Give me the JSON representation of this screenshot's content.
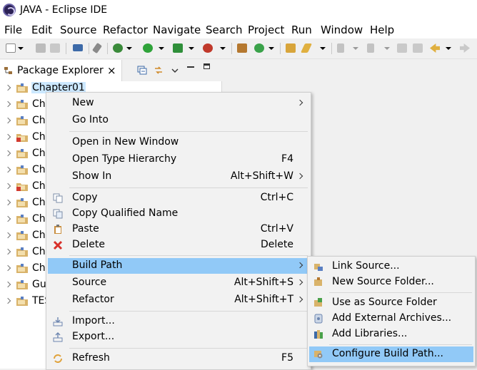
{
  "window": {
    "title": "JAVA - Eclipse IDE"
  },
  "menubar": [
    "File",
    "Edit",
    "Source",
    "Refactor",
    "Navigate",
    "Search",
    "Project",
    "Run",
    "Window",
    "Help"
  ],
  "package_explorer": {
    "tab_title": "Package Explorer",
    "close_glyph": "×",
    "items": [
      {
        "label": "Chapter01"
      },
      {
        "label": "Ch"
      },
      {
        "label": "Ch"
      },
      {
        "label": "Ch"
      },
      {
        "label": "Ch"
      },
      {
        "label": "Ch"
      },
      {
        "label": "Ch"
      },
      {
        "label": "Ch"
      },
      {
        "label": "Ch"
      },
      {
        "label": "Ch"
      },
      {
        "label": "Ch"
      },
      {
        "label": "Ch"
      },
      {
        "label": "Gu"
      },
      {
        "label": "TES"
      }
    ]
  },
  "context_menu": {
    "new": "New",
    "go_into": "Go Into",
    "open_new_window": "Open in New Window",
    "open_type_hierarchy": "Open Type Hierarchy",
    "open_type_hierarchy_sc": "F4",
    "show_in": "Show In",
    "show_in_sc": "Alt+Shift+W",
    "copy": "Copy",
    "copy_sc": "Ctrl+C",
    "copy_qualified": "Copy Qualified Name",
    "paste": "Paste",
    "paste_sc": "Ctrl+V",
    "delete": "Delete",
    "delete_sc": "Delete",
    "build_path": "Build Path",
    "source": "Source",
    "source_sc": "Alt+Shift+S",
    "refactor": "Refactor",
    "refactor_sc": "Alt+Shift+T",
    "import": "Import...",
    "export": "Export...",
    "refresh": "Refresh",
    "refresh_sc": "F5"
  },
  "build_path_submenu": {
    "link_source": "Link Source...",
    "new_source_folder": "New Source Folder...",
    "use_as_source": "Use as Source Folder",
    "add_external_archives": "Add External Archives...",
    "add_libraries": "Add Libraries...",
    "configure_build_path": "Configure Build Path..."
  }
}
